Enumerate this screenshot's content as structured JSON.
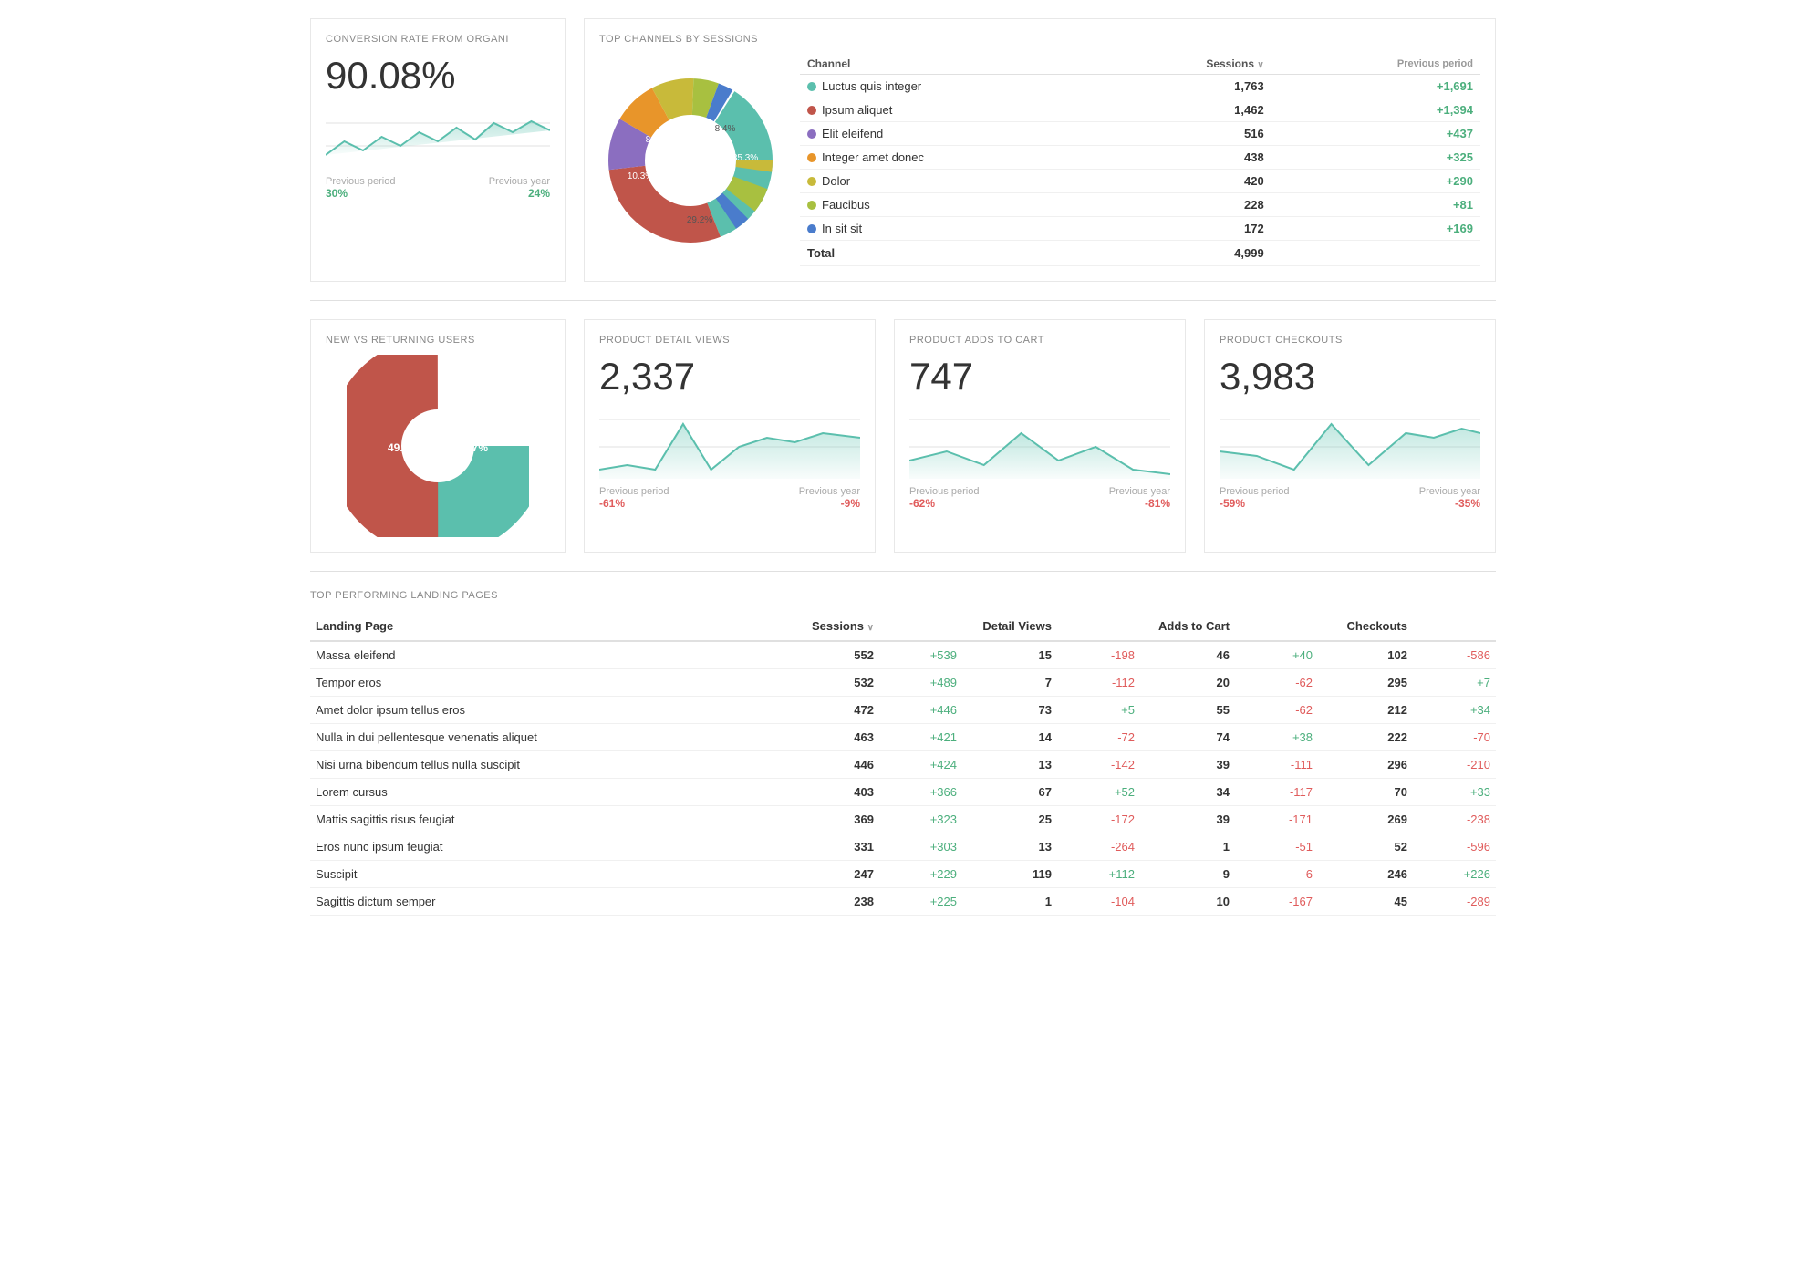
{
  "widgets": {
    "conversion": {
      "title": "CONVERSION RATE FROM ORGANI",
      "value": "90.08%",
      "prev_period_label": "Previous period",
      "prev_period_val": "30%",
      "prev_year_label": "Previous year",
      "prev_year_val": "24%"
    },
    "channels": {
      "title": "TOP CHANNELS BY SESSIONS",
      "col_channel": "Channel",
      "col_sessions": "Sessions",
      "col_prev_period": "Previous period",
      "total_label": "Total",
      "total_val": "4,999",
      "rows": [
        {
          "color": "#5bbfad",
          "name": "Luctus quis integer",
          "sessions": "1,763",
          "diff": "+1,691"
        },
        {
          "color": "#c0554a",
          "name": "Ipsum aliquet",
          "sessions": "1,462",
          "diff": "+1,394"
        },
        {
          "color": "#8b6ec0",
          "name": "Elit eleifend",
          "sessions": "516",
          "diff": "+437"
        },
        {
          "color": "#e8952a",
          "name": "Integer amet donec",
          "sessions": "438",
          "diff": "+325"
        },
        {
          "color": "#c8ba3a",
          "name": "Dolor",
          "sessions": "420",
          "diff": "+290"
        },
        {
          "color": "#a8c040",
          "name": "Faucibus",
          "sessions": "228",
          "diff": "+81"
        },
        {
          "color": "#4a7ccc",
          "name": "In sit sit",
          "sessions": "172",
          "diff": "+169"
        }
      ]
    },
    "new_vs_returning": {
      "title": "NEW VS RETURNING USERS",
      "returning_pct": "49.3%",
      "new_pct": "50.7%"
    },
    "product_detail_views": {
      "title": "PRODUCT DETAIL VIEWS",
      "value": "2,337",
      "prev_period_label": "Previous period",
      "prev_period_val": "-61%",
      "prev_year_label": "Previous year",
      "prev_year_val": "-9%"
    },
    "product_adds_to_cart": {
      "title": "PRODUCT ADDS TO CART",
      "value": "747",
      "prev_period_label": "Previous period",
      "prev_period_val": "-62%",
      "prev_year_label": "Previous year",
      "prev_year_val": "-81%"
    },
    "product_checkouts": {
      "title": "PRODUCT CHECKOUTS",
      "value": "3,983",
      "prev_period_label": "Previous period",
      "prev_period_val": "-59%",
      "prev_year_label": "Previous year",
      "prev_year_val": "-35%"
    }
  },
  "landing_pages": {
    "title": "TOP PERFORMING LANDING PAGES",
    "cols": {
      "page": "Landing Page",
      "sessions": "Sessions",
      "detail_views": "Detail Views",
      "adds_to_cart": "Adds to Cart",
      "checkouts": "Checkouts"
    },
    "rows": [
      {
        "page": "Massa eleifend",
        "sessions": "552",
        "sessions_diff": "+539",
        "detail": "15",
        "detail_diff": "-198",
        "cart": "46",
        "cart_diff": "+40",
        "checkouts": "102",
        "checkouts_diff": "-586"
      },
      {
        "page": "Tempor eros",
        "sessions": "532",
        "sessions_diff": "+489",
        "detail": "7",
        "detail_diff": "-112",
        "cart": "20",
        "cart_diff": "-62",
        "checkouts": "295",
        "checkouts_diff": "+7"
      },
      {
        "page": "Amet dolor ipsum tellus eros",
        "sessions": "472",
        "sessions_diff": "+446",
        "detail": "73",
        "detail_diff": "+5",
        "cart": "55",
        "cart_diff": "-62",
        "checkouts": "212",
        "checkouts_diff": "+34"
      },
      {
        "page": "Nulla in dui pellentesque venenatis aliquet",
        "sessions": "463",
        "sessions_diff": "+421",
        "detail": "14",
        "detail_diff": "-72",
        "cart": "74",
        "cart_diff": "+38",
        "checkouts": "222",
        "checkouts_diff": "-70"
      },
      {
        "page": "Nisi urna bibendum tellus nulla suscipit",
        "sessions": "446",
        "sessions_diff": "+424",
        "detail": "13",
        "detail_diff": "-142",
        "cart": "39",
        "cart_diff": "-111",
        "checkouts": "296",
        "checkouts_diff": "-210"
      },
      {
        "page": "Lorem cursus",
        "sessions": "403",
        "sessions_diff": "+366",
        "detail": "67",
        "detail_diff": "+52",
        "cart": "34",
        "cart_diff": "-117",
        "checkouts": "70",
        "checkouts_diff": "+33"
      },
      {
        "page": "Mattis sagittis risus feugiat",
        "sessions": "369",
        "sessions_diff": "+323",
        "detail": "25",
        "detail_diff": "-172",
        "cart": "39",
        "cart_diff": "-171",
        "checkouts": "269",
        "checkouts_diff": "-238"
      },
      {
        "page": "Eros nunc ipsum feugiat",
        "sessions": "331",
        "sessions_diff": "+303",
        "detail": "13",
        "detail_diff": "-264",
        "cart": "1",
        "cart_diff": "-51",
        "checkouts": "52",
        "checkouts_diff": "-596"
      },
      {
        "page": "Suscipit",
        "sessions": "247",
        "sessions_diff": "+229",
        "detail": "119",
        "detail_diff": "+112",
        "cart": "9",
        "cart_diff": "-6",
        "checkouts": "246",
        "checkouts_diff": "+226"
      },
      {
        "page": "Sagittis dictum semper",
        "sessions": "238",
        "sessions_diff": "+225",
        "detail": "1",
        "detail_diff": "-104",
        "cart": "10",
        "cart_diff": "-167",
        "checkouts": "45",
        "checkouts_diff": "-289"
      }
    ]
  }
}
